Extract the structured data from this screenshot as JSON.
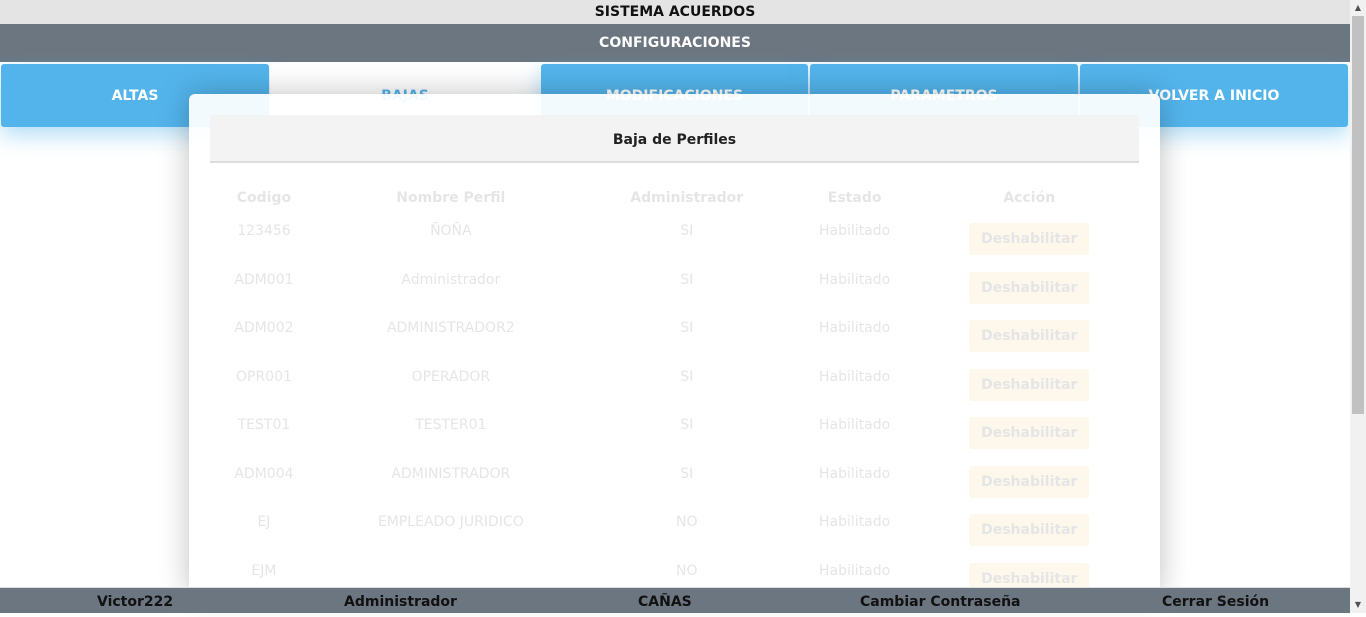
{
  "app": {
    "title": "SISTEMA ACUERDOS",
    "section": "CONFIGURACIONES"
  },
  "tabs": [
    {
      "label": "ALTAS"
    },
    {
      "label": "BAJAS"
    },
    {
      "label": "MODIFICACIONES"
    },
    {
      "label": "PARAMETROS"
    },
    {
      "label": "VOLVER A INICIO"
    }
  ],
  "modal": {
    "title": "Baja de Perfiles",
    "columns": [
      "Codigo",
      "Nombre Perfil",
      "Administrador",
      "Estado",
      "Acción"
    ],
    "rows": [
      {
        "codigo": "123456",
        "nombre": "ÑOÑA",
        "admin": "SI",
        "estado": "Habilitado",
        "accion": "Deshabilitar"
      },
      {
        "codigo": "ADM001",
        "nombre": "Administrador",
        "admin": "SI",
        "estado": "Habilitado",
        "accion": "Deshabilitar"
      },
      {
        "codigo": "ADM002",
        "nombre": "ADMINISTRADOR2",
        "admin": "SI",
        "estado": "Habilitado",
        "accion": "Deshabilitar"
      },
      {
        "codigo": "OPR001",
        "nombre": "OPERADOR",
        "admin": "SI",
        "estado": "Habilitado",
        "accion": "Deshabilitar"
      },
      {
        "codigo": "TEST01",
        "nombre": "TESTER01",
        "admin": "SI",
        "estado": "Habilitado",
        "accion": "Deshabilitar"
      },
      {
        "codigo": "ADM004",
        "nombre": "ADMINISTRADOR",
        "admin": "SI",
        "estado": "Habilitado",
        "accion": "Deshabilitar"
      },
      {
        "codigo": "EJ",
        "nombre": "EMPLEADO JURIDICO",
        "admin": "NO",
        "estado": "Habilitado",
        "accion": "Deshabilitar"
      },
      {
        "codigo": "EJM",
        "nombre": "",
        "admin": "NO",
        "estado": "Habilitado",
        "accion": "Deshabilitar"
      }
    ]
  },
  "footer": {
    "user": "Victor222",
    "role": "Administrador",
    "location": "CAÑAS",
    "change_password": "Cambiar Contraseña",
    "logout": "Cerrar Sesión"
  },
  "colors": {
    "tab_blue": "#53b4eb",
    "header_gray": "#6c7680"
  }
}
